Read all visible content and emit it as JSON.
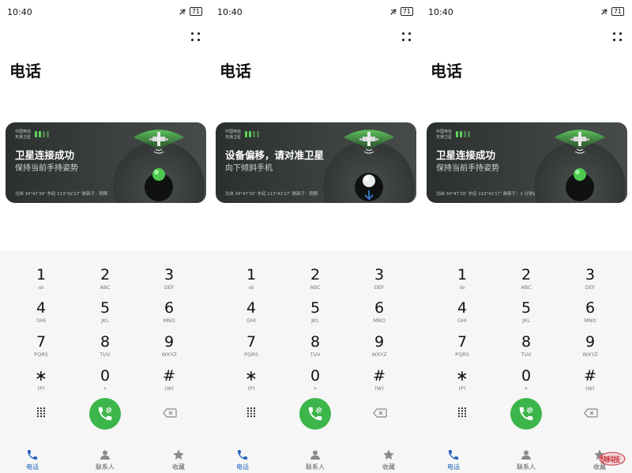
{
  "screens": [
    {
      "status": {
        "time": "10:40",
        "battery": "71"
      },
      "title": "电话",
      "card": {
        "carrier": [
          "中国电信",
          "天通卫星"
        ],
        "heading": "卫星连接成功",
        "sub": "保持当前手持姿势",
        "coords": "北纬 34°47′39″  东经 113°42′17″  刷新于：刚刚",
        "state": "connected"
      }
    },
    {
      "status": {
        "time": "10:40",
        "battery": "71"
      },
      "title": "电话",
      "card": {
        "carrier": [
          "中国电信",
          "天通卫星"
        ],
        "heading": "设备偏移，请对准卫星",
        "sub": "向下倾斜手机",
        "coords": "北纬 34°47′39″  东经 113°42′17″  刷新于：刚刚",
        "state": "offset"
      }
    },
    {
      "status": {
        "time": "10:40",
        "battery": "71"
      },
      "title": "电话",
      "card": {
        "carrier": [
          "中国电信",
          "天通卫星"
        ],
        "heading": "卫星连接成功",
        "sub": "保持当前手持姿势",
        "coords": "北纬 34°47′39″  东经 113°42′17″  刷新于：1 分钟前",
        "state": "connected"
      }
    }
  ],
  "keypad": [
    {
      "digit": "1",
      "sub": "ꝏ"
    },
    {
      "digit": "2",
      "sub": "ABC"
    },
    {
      "digit": "3",
      "sub": "DEF"
    },
    {
      "digit": "4",
      "sub": "GHI"
    },
    {
      "digit": "5",
      "sub": "JKL"
    },
    {
      "digit": "6",
      "sub": "MNO"
    },
    {
      "digit": "7",
      "sub": "PQRS"
    },
    {
      "digit": "8",
      "sub": "TUV"
    },
    {
      "digit": "9",
      "sub": "WXYZ"
    },
    {
      "digit": "∗",
      "sub": "(P)"
    },
    {
      "digit": "0",
      "sub": "+"
    },
    {
      "digit": "#",
      "sub": "(W)"
    }
  ],
  "tabs": [
    {
      "label": "电话",
      "icon": "phone-icon",
      "active": true
    },
    {
      "label": "联系人",
      "icon": "contacts-icon",
      "active": false
    },
    {
      "label": "收藏",
      "icon": "star-icon",
      "active": false
    }
  ],
  "colors": {
    "call_green": "#3cb54a",
    "tab_active": "#1f5fbf",
    "signal_green": "#5bd35b"
  },
  "watermark": {
    "text": "快科技"
  }
}
